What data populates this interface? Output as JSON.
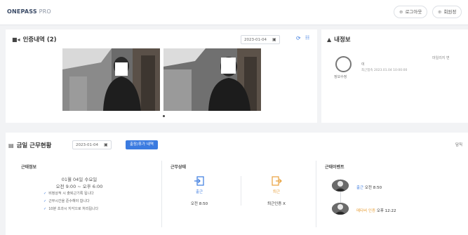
{
  "app": {
    "logo_main": "ONEPASS",
    "logo_suffix": " PRO"
  },
  "header": {
    "logout_label": "로그아웃",
    "member_label": "회원정"
  },
  "auth": {
    "title": "인증내역 (2)",
    "date": "2023-01-04"
  },
  "profile": {
    "title": "내정보",
    "right_text": "마일리지 변",
    "line1": "이",
    "line2": "최근접속 2023.01.04 10:00:00",
    "edit_label": "정보수정"
  },
  "today": {
    "title": "금일 근무현황",
    "date": "2023-01-04",
    "request_button": "출장/휴가 내역",
    "right_text": "담직"
  },
  "work_info": {
    "label": "근태정보",
    "date_line": "01월 04일 수요일",
    "time_line": "오전 9:00 ~ 오후 6:00",
    "notes": [
      "비정상적 시 출퇴근기록 됩니다",
      "근무시간을 준수해야 합니다",
      "10분 초과시 지각으로 처리됩니다"
    ]
  },
  "work_status": {
    "label": "근무상태",
    "in_label": "출근",
    "in_time": "오전 8:50",
    "out_label": "퇴근",
    "out_status": "퇴근인증 X"
  },
  "events": {
    "label": "근태이벤트",
    "items": [
      {
        "type": "출근",
        "time": "오전 8:50"
      },
      {
        "type": "메타버 인증",
        "time": "오후 12:22"
      }
    ]
  },
  "colors": {
    "accent": "#3b7be0",
    "clock_out": "#e8a13c"
  }
}
